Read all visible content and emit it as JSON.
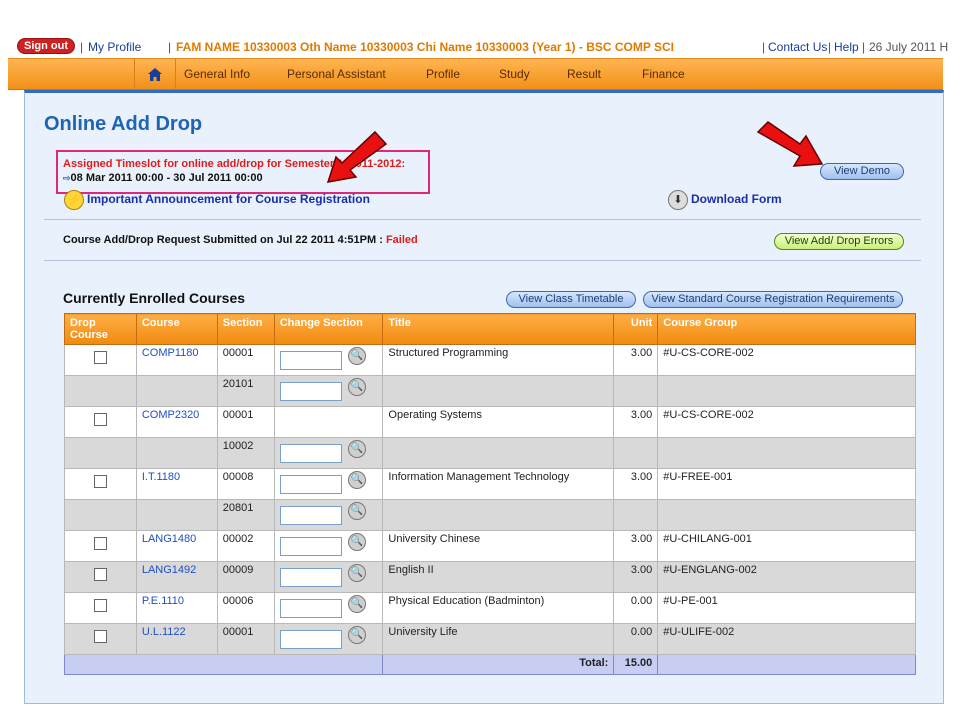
{
  "topbar": {
    "signout": "Sign out",
    "my_profile": "My Profile",
    "student": "FAM NAME 10330003 Oth Name 10330003 Chi Name 10330003 (Year 1) - BSC COMP SCI",
    "contact": "Contact Us",
    "help": "Help",
    "date": "26 July 2011 H"
  },
  "nav": {
    "home_icon": "home-icon",
    "items": [
      "General Info",
      "Personal Assistant",
      "Profile",
      "Study",
      "Result",
      "Finance"
    ]
  },
  "page": {
    "title": "Online Add Drop",
    "timeslot_line1": "Assigned Timeslot for online add/drop for Semester 1, 2011-2012:",
    "timeslot_line2": "08 Mar 2011 00:00 - 30 Jul 2011 00:00",
    "announcement": "Important Announcement for Course Registration",
    "download_form": "Download Form",
    "view_demo": "View Demo",
    "request_text": "Course Add/Drop Request Submitted on Jul 22 2011 4:51PM :",
    "request_status": "Failed",
    "view_errors": "View Add/ Drop Errors",
    "enrolled_title": "Currently Enrolled Courses",
    "view_timetable": "View Class Timetable",
    "view_requirements": "View Standard Course Registration Requirements"
  },
  "table": {
    "headers": {
      "drop": "Drop Course",
      "course": "Course",
      "section": "Section",
      "change": "Change Section",
      "title": "Title",
      "unit": "Unit",
      "group": "Course Group"
    },
    "rows": [
      {
        "course": "COMP1180",
        "section": "00001",
        "title": "Structured Programming",
        "unit": "3.00",
        "group": "#U-CS-CORE-002"
      },
      {
        "course": "",
        "section": "20101",
        "title": "",
        "unit": "",
        "group": ""
      },
      {
        "course": "COMP2320",
        "section": "00001",
        "title": "Operating Systems",
        "unit": "3.00",
        "group": "#U-CS-CORE-002"
      },
      {
        "course": "",
        "section": "10002",
        "title": "",
        "unit": "",
        "group": ""
      },
      {
        "course": "I.T.1180",
        "section": "00008",
        "title": "Information Management Technology",
        "unit": "3.00",
        "group": "#U-FREE-001"
      },
      {
        "course": "",
        "section": "20801",
        "title": "",
        "unit": "",
        "group": ""
      },
      {
        "course": "LANG1480",
        "section": "00002",
        "title": "University Chinese",
        "unit": "3.00",
        "group": "#U-CHILANG-001"
      },
      {
        "course": "LANG1492",
        "section": "00009",
        "title": "English II",
        "unit": "3.00",
        "group": "#U-ENGLANG-002"
      },
      {
        "course": "P.E.1110",
        "section": "00006",
        "title": "Physical Education (Badminton)",
        "unit": "0.00",
        "group": "#U-PE-001"
      },
      {
        "course": "U.L.1122",
        "section": "00001",
        "title": "University Life",
        "unit": "0.00",
        "group": "#U-ULIFE-002"
      }
    ],
    "total_label": "Total:",
    "total_value": "15.00"
  },
  "colors": {
    "accent_orange": "#f29018",
    "title_blue": "#1f63b5",
    "alert_red": "#e01b1b",
    "highlight_pink": "#e0287a"
  }
}
